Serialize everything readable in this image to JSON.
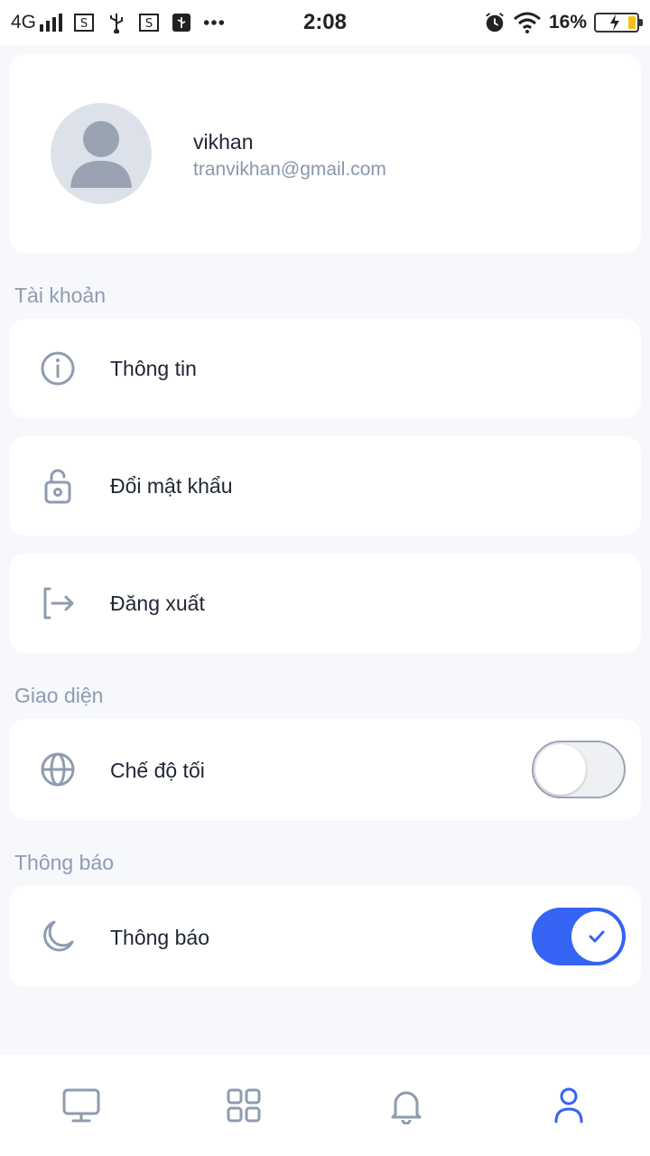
{
  "status_bar": {
    "network": "4G",
    "time": "2:08",
    "battery_percent": "16%"
  },
  "profile": {
    "name": "vikhan",
    "email": "tranvikhan@gmail.com"
  },
  "sections": {
    "account": {
      "title": "Tài khoản",
      "items": [
        {
          "label": "Thông tin",
          "icon": "info-icon"
        },
        {
          "label": "Đổi mật khẩu",
          "icon": "unlock-icon"
        },
        {
          "label": "Đăng xuất",
          "icon": "logout-icon"
        }
      ]
    },
    "appearance": {
      "title": "Giao diện",
      "items": [
        {
          "label": "Chế độ tối",
          "icon": "globe-icon",
          "toggle": false
        }
      ]
    },
    "notifications": {
      "title": "Thông báo",
      "items": [
        {
          "label": "Thông báo",
          "icon": "moon-icon",
          "toggle": true
        }
      ]
    }
  },
  "bottom_nav": {
    "items": [
      {
        "icon": "monitor-icon",
        "active": false
      },
      {
        "icon": "grid-icon",
        "active": false
      },
      {
        "icon": "bell-icon",
        "active": false
      },
      {
        "icon": "user-icon",
        "active": true
      }
    ]
  },
  "colors": {
    "accent": "#3563f3",
    "icon_gray": "#8f9bb0",
    "background": "#f6f8fc"
  }
}
